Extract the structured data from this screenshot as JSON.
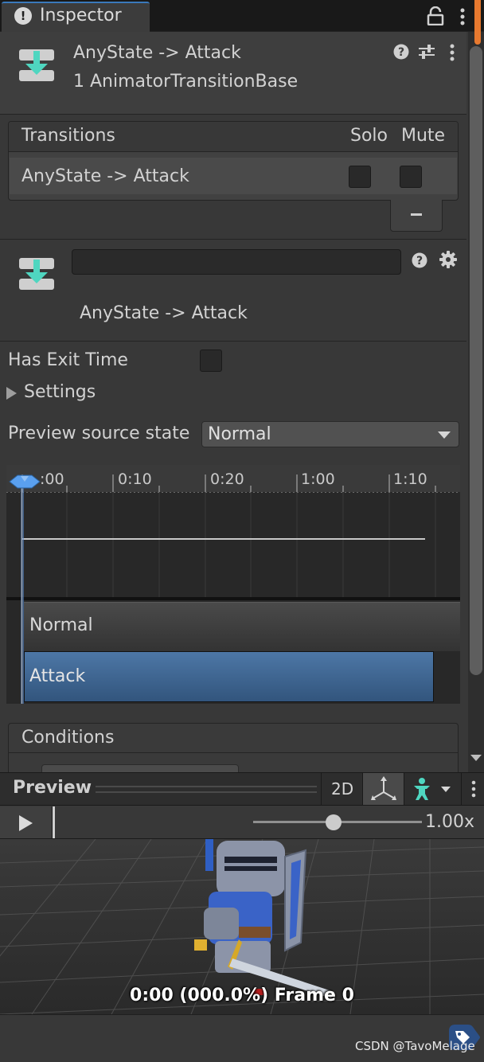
{
  "tab": {
    "label": "Inspector"
  },
  "header": {
    "title": "AnyState -> Attack",
    "subtitle": "1 AnimatorTransitionBase"
  },
  "transitions": {
    "heading": "Transitions",
    "solo_label": "Solo",
    "mute_label": "Mute",
    "rows": [
      {
        "label": "AnyState -> Attack",
        "solo": false,
        "mute": false
      }
    ]
  },
  "detail": {
    "name_value": "",
    "title": "AnyState -> Attack",
    "has_exit_time_label": "Has Exit Time",
    "has_exit_time": false,
    "settings_label": "Settings",
    "preview_source_label": "Preview source state",
    "preview_source_value": "Normal"
  },
  "timeline": {
    "ticks": [
      ":00",
      "0:10",
      "0:20",
      "1:00",
      "1:10"
    ],
    "tracks": [
      "Normal",
      "Attack"
    ]
  },
  "conditions": {
    "heading": "Conditions"
  },
  "preview": {
    "label": "Preview",
    "btn_2d": "2D",
    "speed": "1.00x",
    "frame_label": "0:00 (000.0%) Frame 0"
  },
  "watermark": "CSDN @TavoMelage",
  "colors": {
    "accent_blue": "#3a79bb",
    "attack_track": "#4d77a6",
    "scroll_accent": "#e7792f",
    "transition_icon": "#4fd6c0"
  },
  "icons": [
    "info-icon",
    "lock-icon",
    "kebab-icon",
    "transition-icon",
    "help-icon",
    "presets-icon",
    "gear-icon",
    "pivot-icon",
    "avatar-icon",
    "tag-icon"
  ]
}
